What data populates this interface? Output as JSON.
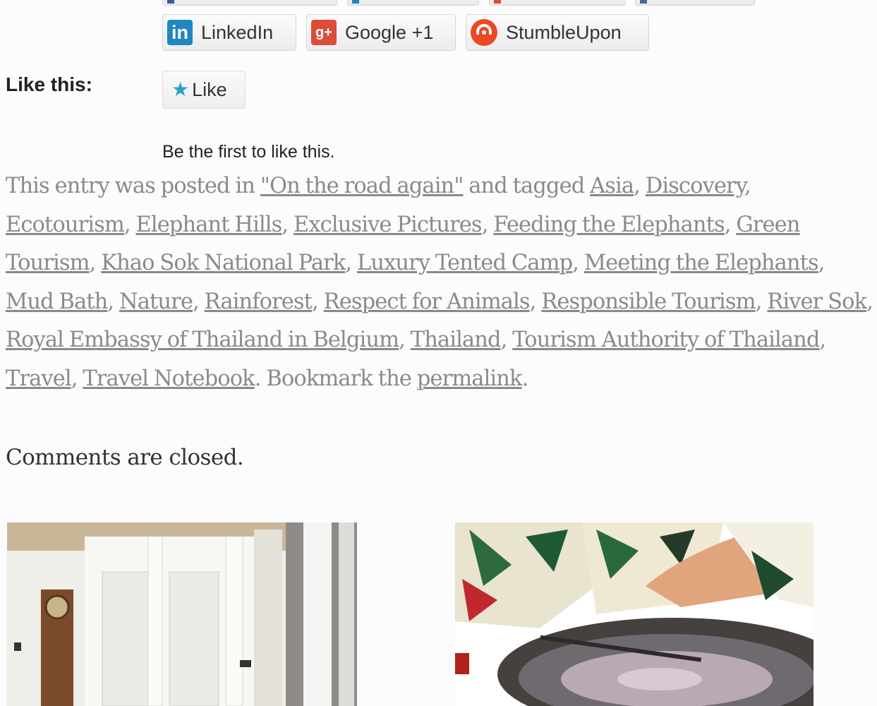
{
  "share": {
    "buttons": [
      {
        "label": "LinkedIn",
        "icon": "linkedin-icon",
        "color": "#1f88be"
      },
      {
        "label": "Google +1",
        "icon": "google-plus-icon",
        "color": "#dd4b39"
      },
      {
        "label": "StumbleUpon",
        "icon": "stumbleupon-icon",
        "color": "#eb4823"
      }
    ],
    "linkedin_glyph": "in",
    "gplus_glyph": "g+"
  },
  "like": {
    "label": "Like this:",
    "button_label": "Like",
    "star": "★",
    "first_like_text": "Be the first to like this."
  },
  "entry_meta": {
    "prefix": "This entry was posted in",
    "category": "\"On the road again\"",
    "tagged_text": "and tagged",
    "tags": [
      "Asia",
      "Discovery",
      "Ecotourism",
      "Elephant Hills",
      "Exclusive Pictures",
      "Feeding the Elephants",
      "Green Tourism",
      "Khao Sok National Park",
      "Luxury Tented Camp",
      "Meeting the Elephants",
      "Mud Bath",
      "Nature",
      "Rainforest",
      "Respect for Animals",
      "Responsible Tourism",
      "River Sok",
      "Royal Embassy of Thailand in Belgium",
      "Thailand",
      "Tourism Authority of Thailand",
      "Travel",
      "Travel Notebook"
    ],
    "bookmark_text": "Bookmark the",
    "permalink_label": "permalink"
  },
  "comments_closed": "Comments are closed.",
  "colors": {
    "link": "#8a8a8a",
    "like_star": "#2ea2cc"
  }
}
